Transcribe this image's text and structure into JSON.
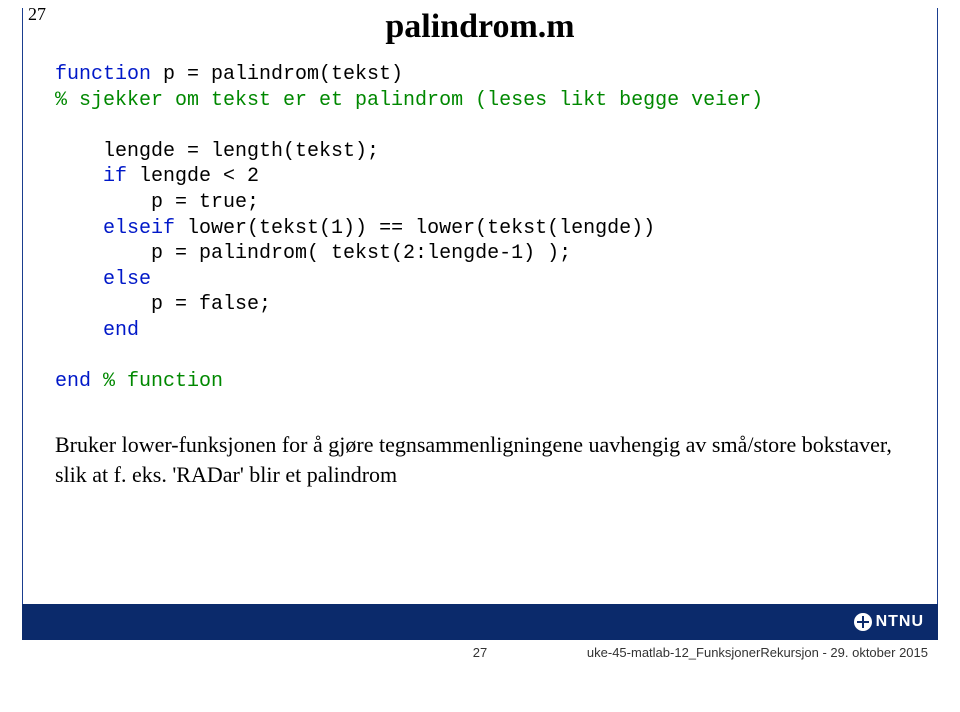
{
  "slide_number_top": "27",
  "title": "palindrom.m",
  "code": {
    "l1_kw": "function",
    "l1_rest": " p = palindrom(tekst)",
    "l2_cmt": "% sjekker om tekst er et palindrom (leses likt begge veier)",
    "l4": "    lengde = length(tekst);",
    "l5a": "    ",
    "l5_kw": "if",
    "l5b": " lengde < 2",
    "l6": "        p = true;",
    "l7a": "    ",
    "l7_kw": "elseif",
    "l7b": " lower(tekst(1)) == lower(tekst(lengde))",
    "l8": "        p = palindrom( tekst(2:lengde-1) );",
    "l9a": "    ",
    "l9_kw": "else",
    "l10": "        p = false;",
    "l11a": "    ",
    "l11_kw": "end",
    "l13_kw": "end",
    "l13_cmt": " % function"
  },
  "caption": "Bruker lower-funksjonen for å gjøre tegnsammenligningene uavhengig av små/store bokstaver, slik at f. eks. 'RADar' blir et palindrom",
  "footer": {
    "page": "27",
    "doc": "uke-45-matlab-12_FunksjonerRekursjon - 29. oktober 2015",
    "logo": "NTNU"
  }
}
